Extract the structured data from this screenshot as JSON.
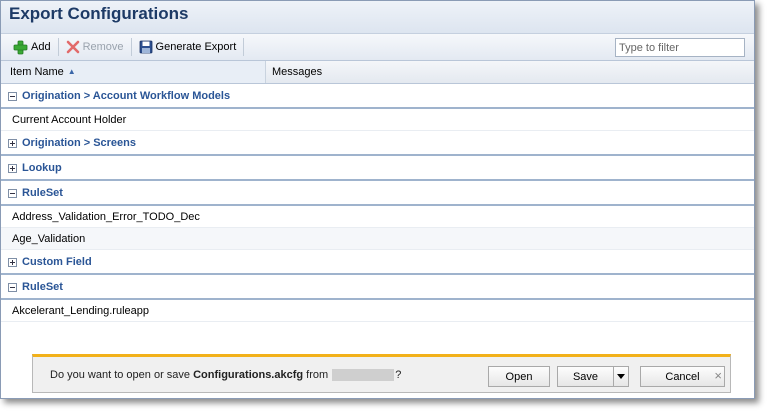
{
  "header": {
    "title": "Export Configurations"
  },
  "toolbar": {
    "add_label": "Add",
    "remove_label": "Remove",
    "generate_label": "Generate Export",
    "filter_placeholder": "Type to filter"
  },
  "columns": {
    "item_name": "Item Name",
    "messages": "Messages"
  },
  "groups": [
    {
      "label": "Origination > Account Workflow Models",
      "expanded": true,
      "items": [
        "Current Account Holder"
      ]
    },
    {
      "label": "Origination > Screens",
      "expanded": false,
      "items": []
    },
    {
      "label": "Lookup",
      "expanded": false,
      "items": []
    },
    {
      "label": "RuleSet",
      "expanded": true,
      "items": [
        "Address_Validation_Error_TODO_Dec",
        "Age_Validation"
      ]
    },
    {
      "label": "Custom Field",
      "expanded": false,
      "items": []
    },
    {
      "label": "RuleSet",
      "expanded": true,
      "items": [
        "Akcelerant_Lending.ruleapp"
      ]
    }
  ],
  "download_bar": {
    "prompt_start": "Do you want to open or save ",
    "filename": "Configurations.akcfg",
    "prompt_from": " from ",
    "prompt_end": "?",
    "open_label": "Open",
    "save_label": "Save",
    "cancel_label": "Cancel",
    "close_glyph": "×"
  }
}
